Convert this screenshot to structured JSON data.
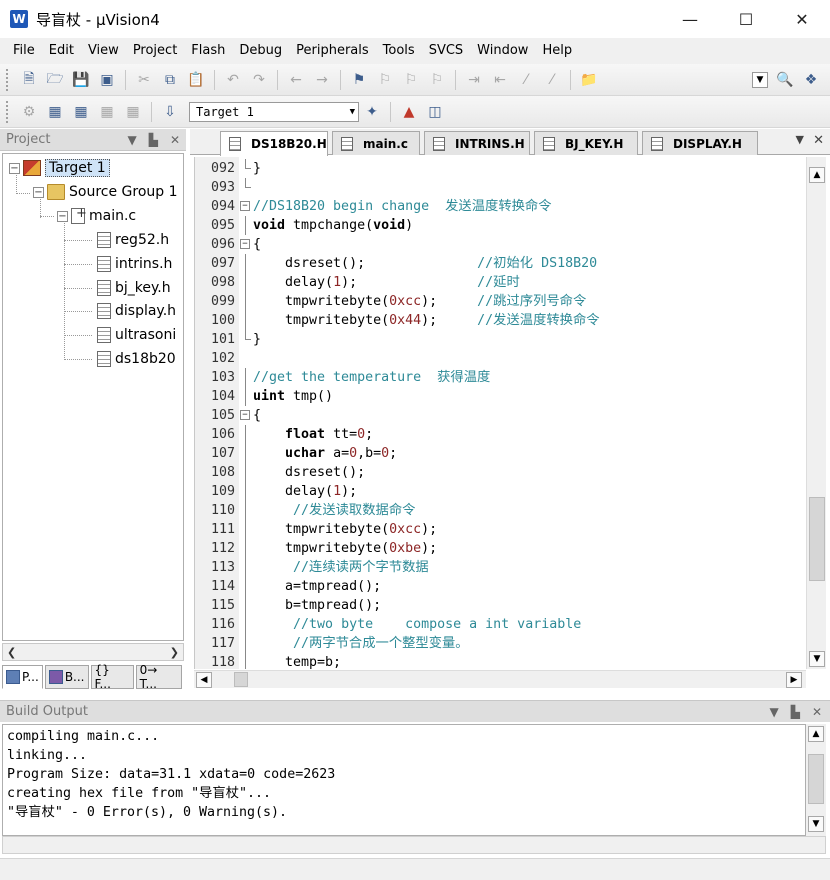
{
  "window": {
    "title": "导盲杖 - µVision4",
    "app_icon_glyph": "W"
  },
  "menu": [
    "File",
    "Edit",
    "View",
    "Project",
    "Flash",
    "Debug",
    "Peripherals",
    "Tools",
    "SVCS",
    "Window",
    "Help"
  ],
  "toolbar": {
    "target_value": "Target 1"
  },
  "project_panel": {
    "title": "Project",
    "tree": {
      "target": "Target 1",
      "group": "Source Group 1",
      "file": "main.c",
      "headers": [
        "reg52.h",
        "intrins.h",
        "bj_key.h",
        "display.h",
        "ultrasoni",
        "ds18b20"
      ]
    },
    "tabs": [
      "P...",
      "B...",
      "{} F...",
      "0→ T..."
    ]
  },
  "editor": {
    "tabs": [
      "DS18B20.H",
      "main.c",
      "INTRINS.H",
      "BJ_KEY.H",
      "DISPLAY.H"
    ],
    "active_tab": "DS18B20.H",
    "lines": [
      {
        "num": "092",
        "text": "}"
      },
      {
        "num": "093",
        "text": ""
      },
      {
        "num": "094",
        "text": "//DS18B20 begin change  发送温度转换命令"
      },
      {
        "num": "095",
        "text": "void tmpchange(void)"
      },
      {
        "num": "096",
        "text": "{"
      },
      {
        "num": "097",
        "text": "    dsreset();              //初始化 DS18B20"
      },
      {
        "num": "098",
        "text": "    delay(1);               //延时"
      },
      {
        "num": "099",
        "text": "    tmpwritebyte(0xcc);     //跳过序列号命令"
      },
      {
        "num": "100",
        "text": "    tmpwritebyte(0x44);     //发送温度转换命令"
      },
      {
        "num": "101",
        "text": "}"
      },
      {
        "num": "102",
        "text": ""
      },
      {
        "num": "103",
        "text": "//get the temperature  获得温度"
      },
      {
        "num": "104",
        "text": "uint tmp()"
      },
      {
        "num": "105",
        "text": "{"
      },
      {
        "num": "106",
        "text": "    float tt=0;"
      },
      {
        "num": "107",
        "text": "    uchar a=0,b=0;"
      },
      {
        "num": "108",
        "text": "    dsreset();"
      },
      {
        "num": "109",
        "text": "    delay(1);"
      },
      {
        "num": "110",
        "text": "     //发送读取数据命令"
      },
      {
        "num": "111",
        "text": "    tmpwritebyte(0xcc);"
      },
      {
        "num": "112",
        "text": "    tmpwritebyte(0xbe);"
      },
      {
        "num": "113",
        "text": "     //连续读两个字节数据"
      },
      {
        "num": "114",
        "text": "    a=tmpread();"
      },
      {
        "num": "115",
        "text": "    b=tmpread();"
      },
      {
        "num": "116",
        "text": "     //two byte    compose a int variable"
      },
      {
        "num": "117",
        "text": "     //两字节合成一个整型变量。"
      },
      {
        "num": "118",
        "text": "    temp=b;"
      }
    ]
  },
  "build_output": {
    "title": "Build Output",
    "lines": [
      "compiling main.c...",
      "linking...",
      "Program Size: data=31.1 xdata=0 code=2623",
      "creating hex file from \"导盲杖\"...",
      "\"导盲杖\" - 0 Error(s), 0 Warning(s)."
    ]
  }
}
